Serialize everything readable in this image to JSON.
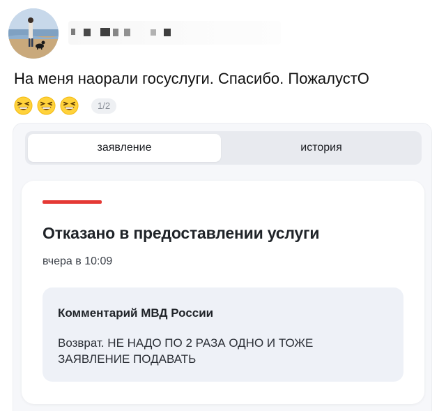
{
  "post": {
    "author_name_blurred": true,
    "text": "На меня наорали госуслуги. Спасибо. ПожалустО",
    "emoji_icons": [
      "grinning-squinting-face-icon",
      "grinning-squinting-face-icon",
      "grinning-squinting-face-icon"
    ],
    "image_counter": "1/2"
  },
  "screenshot": {
    "tabs": [
      {
        "label": "заявление",
        "active": true
      },
      {
        "label": "история",
        "active": false
      }
    ],
    "card": {
      "status_color": "#e53935",
      "title": "Отказано в предоставлении услуги",
      "time": "вчера в 10:09",
      "comment": {
        "title": "Комментарий МВД России",
        "body": "Возврат. НЕ НАДО ПО 2 РАЗА ОДНО И ТОЖЕ ЗАЯВЛЕНИЕ ПОДАВАТЬ"
      }
    }
  }
}
